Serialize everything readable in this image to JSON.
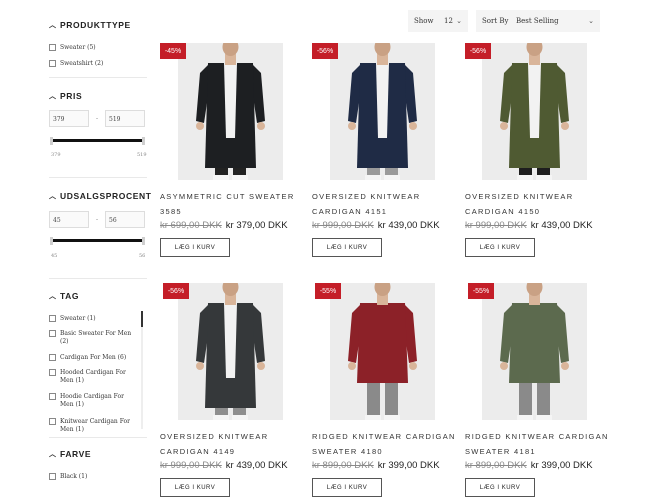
{
  "filters": {
    "product_type": {
      "title": "PRODUKTTYPE",
      "items": [
        {
          "label": "Sweater (5)"
        },
        {
          "label": "Sweatshirt (2)"
        }
      ]
    },
    "price": {
      "title": "PRIS",
      "min_value": "379",
      "max_value": "519",
      "range_min_label": "379",
      "range_max_label": "519",
      "separator": "-"
    },
    "discount": {
      "title": "UDSALGSPROCENT",
      "min_value": "45",
      "max_value": "56",
      "range_min_label": "45",
      "range_max_label": "56",
      "separator": "-"
    },
    "tag": {
      "title": "TAG",
      "items": [
        {
          "label": "Sweater (1)"
        },
        {
          "label": "Basic Sweater For Men (2)"
        },
        {
          "label": "Cardigan For Men (6)"
        },
        {
          "label": "Hooded Cardigan For Men (1)"
        },
        {
          "label": "Hoodie Cardigan For Men (1)"
        },
        {
          "label": "Knitwear Cardigan For Men (1)"
        }
      ]
    },
    "color": {
      "title": "FARVE",
      "items": [
        {
          "label": "Black (1)"
        }
      ]
    }
  },
  "toolbar": {
    "show_label": "Show",
    "show_value": "12",
    "sort_label": "Sort By",
    "sort_value": "Best Selling"
  },
  "products": [
    {
      "badge": "-45%",
      "title_line1": "ASYMMETRIC CUT SWEATER",
      "title_line2": "3585",
      "old_price": "kr 699,00 DKK",
      "new_price": "kr 379,00 DKK",
      "button": "LÆG I KURV",
      "garment_color": "#1d1f22",
      "shirt": "#f2f2f2",
      "pants": "#222222"
    },
    {
      "badge": "-56%",
      "title_line1": "OVERSIZED KNITWEAR",
      "title_line2": "CARDIGAN 4151",
      "old_price": "kr 999,00 DKK",
      "new_price": "kr 439,00 DKK",
      "button": "LÆG I KURV",
      "garment_color": "#1f2b45",
      "shirt": "#f2f2f2",
      "pants": "#9a9a9a"
    },
    {
      "badge": "-56%",
      "title_line1": "OVERSIZED KNITWEAR",
      "title_line2": "CARDIGAN 4150",
      "old_price": "kr 999,00 DKK",
      "new_price": "kr 439,00 DKK",
      "button": "LÆG I KURV",
      "garment_color": "#4f5a32",
      "shirt": "#f2f2f2",
      "pants": "#1e1e1e"
    },
    {
      "badge": "-56%",
      "title_line1": "OVERSIZED KNITWEAR",
      "title_line2": "CARDIGAN 4149",
      "old_price": "kr 999,00 DKK",
      "new_price": "kr 439,00 DKK",
      "button": "LÆG I KURV",
      "garment_color": "#35383a",
      "shirt": "#f2f2f2",
      "pants": "#8e8e8e"
    },
    {
      "badge": "-55%",
      "title_line1": "RIDGED KNITWEAR CARDIGAN",
      "title_line2": "SWEATER 4180",
      "old_price": "kr 899,00 DKK",
      "new_price": "kr 399,00 DKK",
      "button": "LÆG I KURV",
      "garment_color": "#8c2128",
      "shirt": "#8c2128",
      "pants": "#8a8a8a"
    },
    {
      "badge": "-55%",
      "title_line1": "RIDGED KNITWEAR CARDIGAN",
      "title_line2": "SWEATER 4181",
      "old_price": "kr 899,00 DKK",
      "new_price": "kr 399,00 DKK",
      "button": "LÆG I KURV",
      "garment_color": "#5c6a4e",
      "shirt": "#5c6a4e",
      "pants": "#8a8a8a"
    }
  ]
}
